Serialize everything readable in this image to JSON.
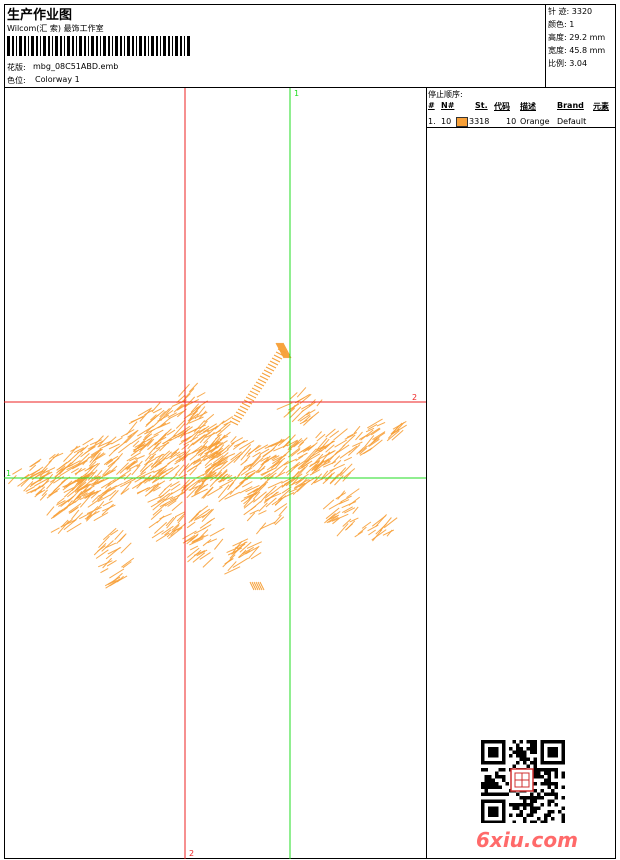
{
  "header": {
    "title": "生产作业图",
    "company": "Wilcom(汇 索) 最饰工作室",
    "design_label": "花版:",
    "design_file": "mbg_08C51ABD.emb",
    "colorway_label": "色位:",
    "colorway": "Colorway 1"
  },
  "stats": {
    "stitches": "针 迹: 3320",
    "colors": "颜色: 1",
    "height": "高度: 29.2 mm",
    "width": "宽度: 45.8 mm",
    "ratio": "比例: 3.04"
  },
  "stop_sequence": {
    "title": "停止顺序:",
    "headers": [
      "#",
      "N#",
      "St.",
      "代码",
      "描述",
      "Brand",
      "元素"
    ],
    "rows": [
      {
        "index": "1.",
        "needle": "10",
        "stitches": "3318",
        "code": "10",
        "description": "Orange",
        "brand": "Default",
        "element": "",
        "color": "#f7a038"
      }
    ]
  },
  "guides": {
    "green_vertical_label": "1",
    "green_horizontal_label": "1",
    "red_horizontal_label": "2",
    "red_vertical_label": "2",
    "green": "#22dd22",
    "red": "#ee2222"
  },
  "design_color": "#f7a038",
  "watermark": "6xiu.com"
}
